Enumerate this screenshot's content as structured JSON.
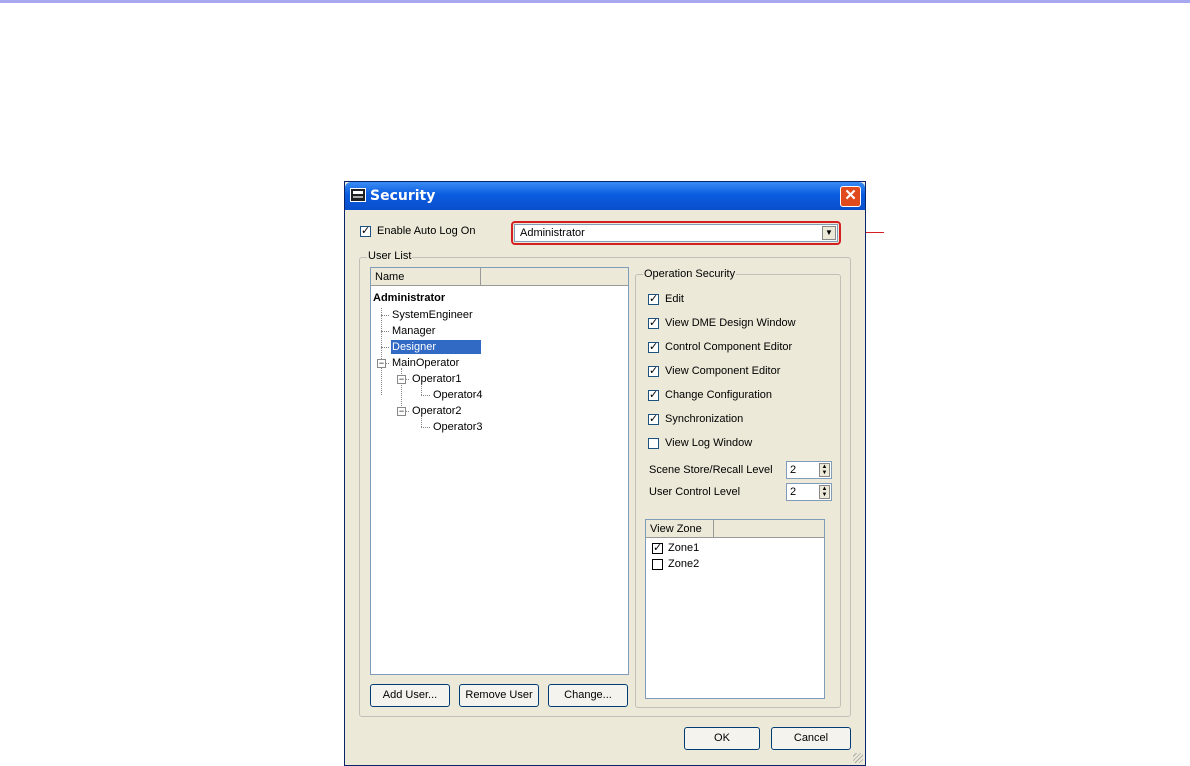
{
  "window": {
    "title": "Security"
  },
  "auto_logon": {
    "label": "Enable Auto Log On",
    "checked": true,
    "selected_user": "Administrator"
  },
  "user_list": {
    "group_label": "User List",
    "column_name": "Name",
    "tree": [
      {
        "label": "Administrator",
        "bold": true
      },
      {
        "label": "SystemEngineer"
      },
      {
        "label": "Manager"
      },
      {
        "label": "Designer",
        "selected": true
      },
      {
        "label": "MainOperator"
      },
      {
        "label": "Operator1"
      },
      {
        "label": "Operator4"
      },
      {
        "label": "Operator2"
      },
      {
        "label": "Operator3"
      }
    ],
    "buttons": {
      "add": "Add User...",
      "remove": "Remove User",
      "change": "Change..."
    }
  },
  "operation_security": {
    "group_label": "Operation Security",
    "checks": [
      {
        "label": "Edit",
        "checked": true
      },
      {
        "label": "View DME Design Window",
        "checked": true
      },
      {
        "label": "Control Component Editor",
        "checked": true
      },
      {
        "label": "View Component Editor",
        "checked": true
      },
      {
        "label": "Change Configuration",
        "checked": true
      },
      {
        "label": "Synchronization",
        "checked": true
      },
      {
        "label": "View Log Window",
        "checked": false
      }
    ],
    "scene_level": {
      "label": "Scene Store/Recall Level",
      "value": "2"
    },
    "user_control_level": {
      "label": "User Control Level",
      "value": "2"
    },
    "view_zone": {
      "column": "View Zone",
      "zones": [
        {
          "label": "Zone1",
          "checked": true
        },
        {
          "label": "Zone2",
          "checked": false
        }
      ]
    }
  },
  "footer": {
    "ok": "OK",
    "cancel": "Cancel"
  }
}
